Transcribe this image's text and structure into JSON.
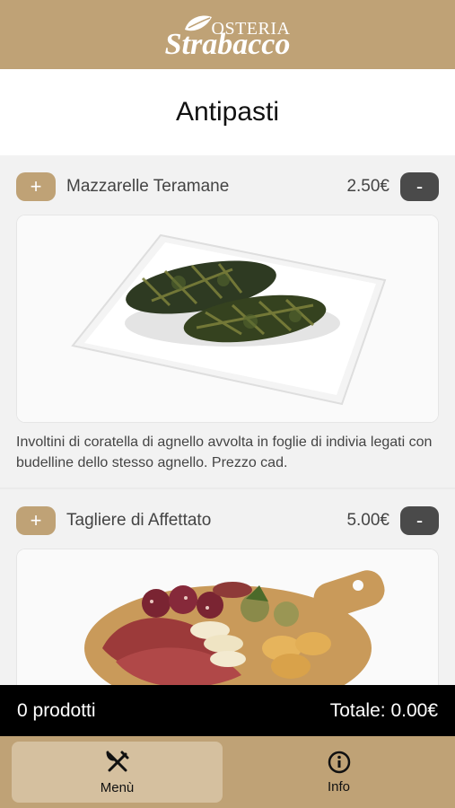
{
  "header": {
    "logo_top": "OSTERIA",
    "logo_bottom": "Strabacco"
  },
  "section_title": "Antipasti",
  "items": [
    {
      "add_label": "+",
      "name": "Mazzarelle Teramane",
      "price": "2.50€",
      "remove_label": "-",
      "image": "rolled-greens-on-white-plate",
      "description": "Involtini di coratella di agnello avvolta in foglie di indivia legati con budelline dello stesso agnello. Prezzo cad."
    },
    {
      "add_label": "+",
      "name": "Tagliere di Affettato",
      "price": "5.00€",
      "remove_label": "-",
      "image": "cured-meats-on-wooden-board",
      "description": ""
    }
  ],
  "cart": {
    "count_text": "0 prodotti",
    "total_text": "Totale: 0.00€"
  },
  "nav": {
    "menu_label": "Menù",
    "info_label": "Info"
  },
  "colors": {
    "brand": "#bfa276",
    "dark_button": "#4a4a4a",
    "cart_bar": "#000000"
  }
}
